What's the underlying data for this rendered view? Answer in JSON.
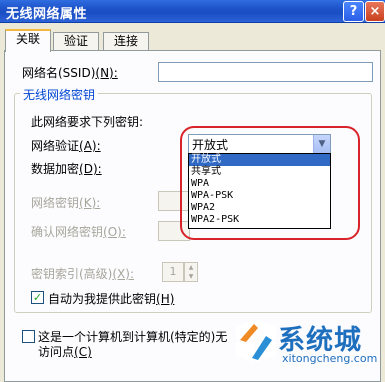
{
  "window": {
    "title": "无线网络属性",
    "help_label": "?",
    "close_label": "×"
  },
  "tabs": [
    {
      "label": "关联",
      "active": true
    },
    {
      "label": "验证",
      "active": false
    },
    {
      "label": "连接",
      "active": false
    }
  ],
  "ssid": {
    "label": "网络名(SSID)",
    "hotkey": "(N):",
    "value": ""
  },
  "key_group": {
    "title": "无线网络密钥",
    "requires_text": "此网络要求下列密钥:",
    "auth_label": "网络验证",
    "auth_hotkey": "(A):",
    "encryption_label": "数据加密",
    "encryption_hotkey": "(D):",
    "key_label": "网络密钥",
    "key_hotkey": "(K):",
    "confirm_label": "确认网络密钥",
    "confirm_hotkey": "(O):",
    "index_label": "密钥索引(高级)",
    "index_hotkey": "(X):",
    "index_value": "1",
    "auto_label": "自动为我提供此密钥",
    "auto_hotkey": "(H)",
    "auto_checked": true,
    "auto_check_mark": "✓"
  },
  "auth_combo": {
    "selected": "开放式",
    "options": [
      "开放式",
      "共享式",
      "WPA",
      "WPA-PSK",
      "WPA2",
      "WPA2-PSK"
    ],
    "highlighted_index": 0
  },
  "adhoc": {
    "line1": "这是一个计算机到计算机(特定的)",
    "line1_tail": "无",
    "line2": "访问点",
    "hotkey": "(C)",
    "checked": false
  },
  "watermark": {
    "brand": "系统城",
    "url": "xitongcheng.com"
  },
  "colors": {
    "accent": "#0046d5",
    "selection": "#316ac5",
    "highlight": "#d8232a",
    "brand": "#1f6fbf"
  }
}
